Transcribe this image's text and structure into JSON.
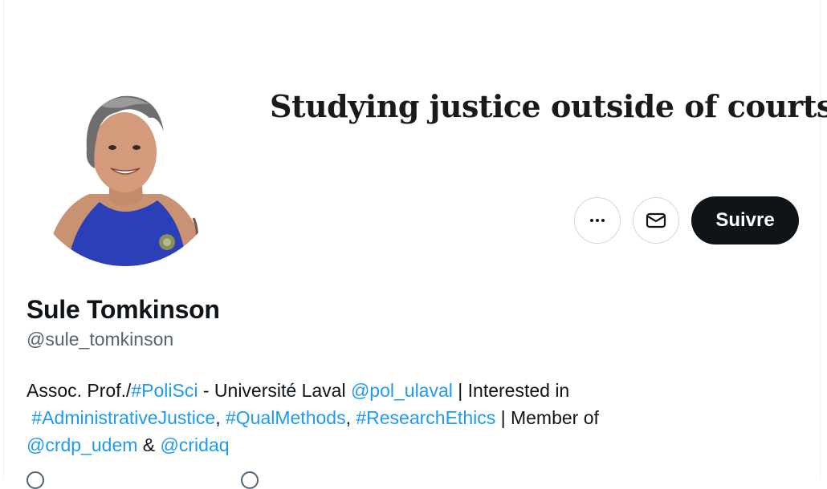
{
  "banner": {
    "text": "Studying justice outside of courts"
  },
  "profile": {
    "name": "Sule Tomkinson",
    "handle": "@sule_tomkinson"
  },
  "actions": {
    "more_icon": "more-horizontal-icon",
    "message_icon": "envelope-icon",
    "follow_label": "Suivre"
  },
  "bio": {
    "prefix": "Assoc. Prof./",
    "tag_polisci": "#PoliSci",
    "mid1": " - Université Laval ",
    "mention_pol": "@pol_ulaval",
    "mid2": " | Interested in ",
    "tag_admin": "#AdministrativeJustice",
    "comma1": ", ",
    "tag_qual": "#QualMethods",
    "comma2": ", ",
    "tag_ethics": "#ResearchEthics",
    "mid3": " | Member of ",
    "mention_crdp": "@crdp_udem",
    "amp": " & ",
    "mention_cridaq": "@cridaq"
  },
  "colors": {
    "link": "#1d9bf0",
    "text": "#0f1419",
    "secondary": "#536471",
    "follow_bg": "#0f1419",
    "dress": "#2a3fb8"
  }
}
